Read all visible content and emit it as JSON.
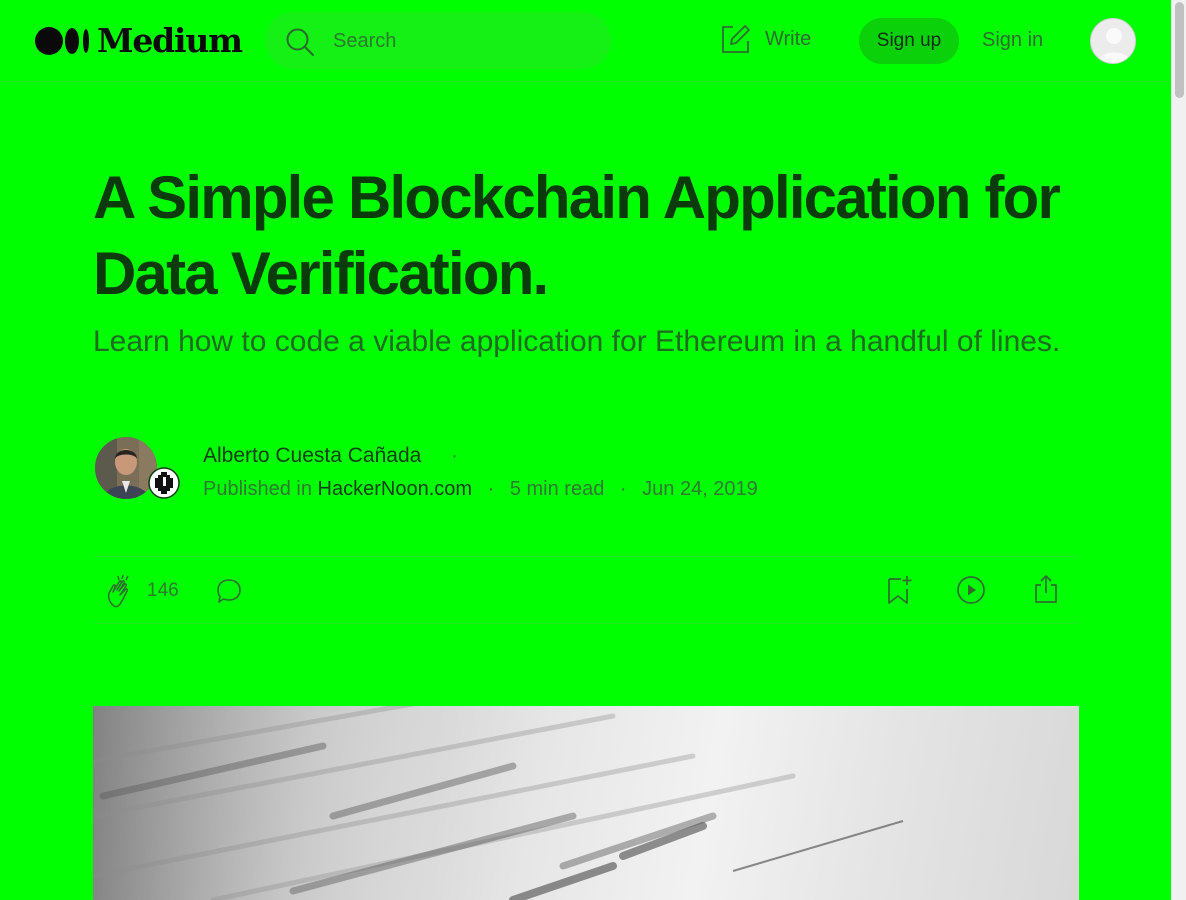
{
  "header": {
    "brand": "Medium",
    "search_placeholder": "Search",
    "write_label": "Write",
    "signup_label": "Sign up",
    "signin_label": "Sign in"
  },
  "article": {
    "title": "A Simple Blockchain Application for Data Verification.",
    "subtitle": "Learn how to code a viable application for Ethereum in a handful of lines.",
    "author": "Alberto Cuesta Cañada",
    "author_dot": "·",
    "published_prefix": "Published in",
    "publication": "HackerNoon.com",
    "sep": "·",
    "read_time": "5 min read",
    "date": "Jun 24, 2019"
  },
  "actions": {
    "clap_count": "146"
  },
  "icons": {
    "search": "search-icon",
    "write": "write-icon",
    "clap": "clap-icon",
    "comment": "comment-icon",
    "bookmark": "bookmark-icon",
    "listen": "play-icon",
    "share": "share-icon"
  },
  "colors": {
    "background": "#00ff00",
    "signup_bg": "#0ad10a"
  }
}
